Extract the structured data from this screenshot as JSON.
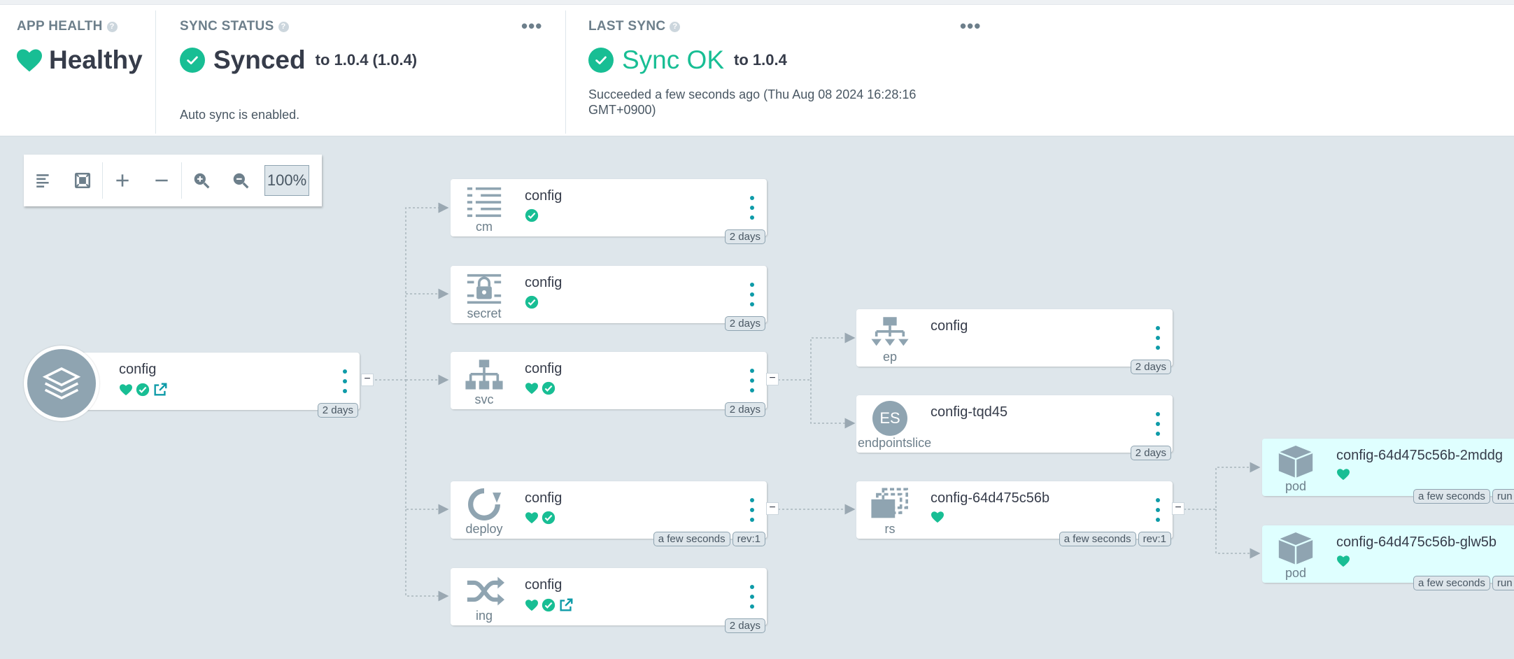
{
  "colors": {
    "ok": "#18be94",
    "accent": "#0e9ba8",
    "bg": "#dee6eb",
    "pod_bg": "#dfffff"
  },
  "app_health": {
    "title": "APP HEALTH",
    "help": "?",
    "status": "Healthy",
    "icon": "heart-icon"
  },
  "sync_status": {
    "title": "SYNC STATUS",
    "help": "?",
    "status": "Synced",
    "to": "to 1.0.4 (1.0.4)",
    "detail": "Auto sync is enabled.",
    "menu": "•••"
  },
  "last_sync": {
    "title": "LAST SYNC",
    "help": "?",
    "status": "Sync OK",
    "to": "to 1.0.4",
    "detail_line1": "Succeeded a few seconds ago (Thu Aug 08 2024 16:28:16",
    "detail_line2": "GMT+0900)",
    "menu": "•••"
  },
  "toolbar": {
    "zoom": "100%",
    "buttons": [
      "align-left-icon",
      "fit-screen-icon",
      "expand-icon",
      "collapse-icon",
      "zoom-in-icon",
      "zoom-out-icon"
    ]
  },
  "nodes": {
    "app": {
      "name": "config",
      "age": "2 days"
    },
    "cm": {
      "name": "config",
      "kind": "cm",
      "age": "2 days"
    },
    "secret": {
      "name": "config",
      "kind": "secret",
      "age": "2 days"
    },
    "svc": {
      "name": "config",
      "kind": "svc",
      "age": "2 days"
    },
    "deploy": {
      "name": "config",
      "kind": "deploy",
      "age": "a few seconds",
      "rev": "rev:1"
    },
    "ing": {
      "name": "config",
      "kind": "ing",
      "age": "2 days"
    },
    "ep": {
      "name": "config",
      "kind": "ep",
      "age": "2 days"
    },
    "endpointslice": {
      "name": "config-tqd45",
      "kind": "endpointslice",
      "badge": "ES",
      "age": "2 days"
    },
    "rs": {
      "name": "config-64d475c56b",
      "kind": "rs",
      "age": "a few seconds",
      "rev": "rev:1"
    },
    "pod1": {
      "name": "config-64d475c56b-2mddg",
      "kind": "pod",
      "age": "a few seconds",
      "extra": "run"
    },
    "pod2": {
      "name": "config-64d475c56b-glw5b",
      "kind": "pod",
      "age": "a few seconds",
      "extra": "run"
    }
  }
}
